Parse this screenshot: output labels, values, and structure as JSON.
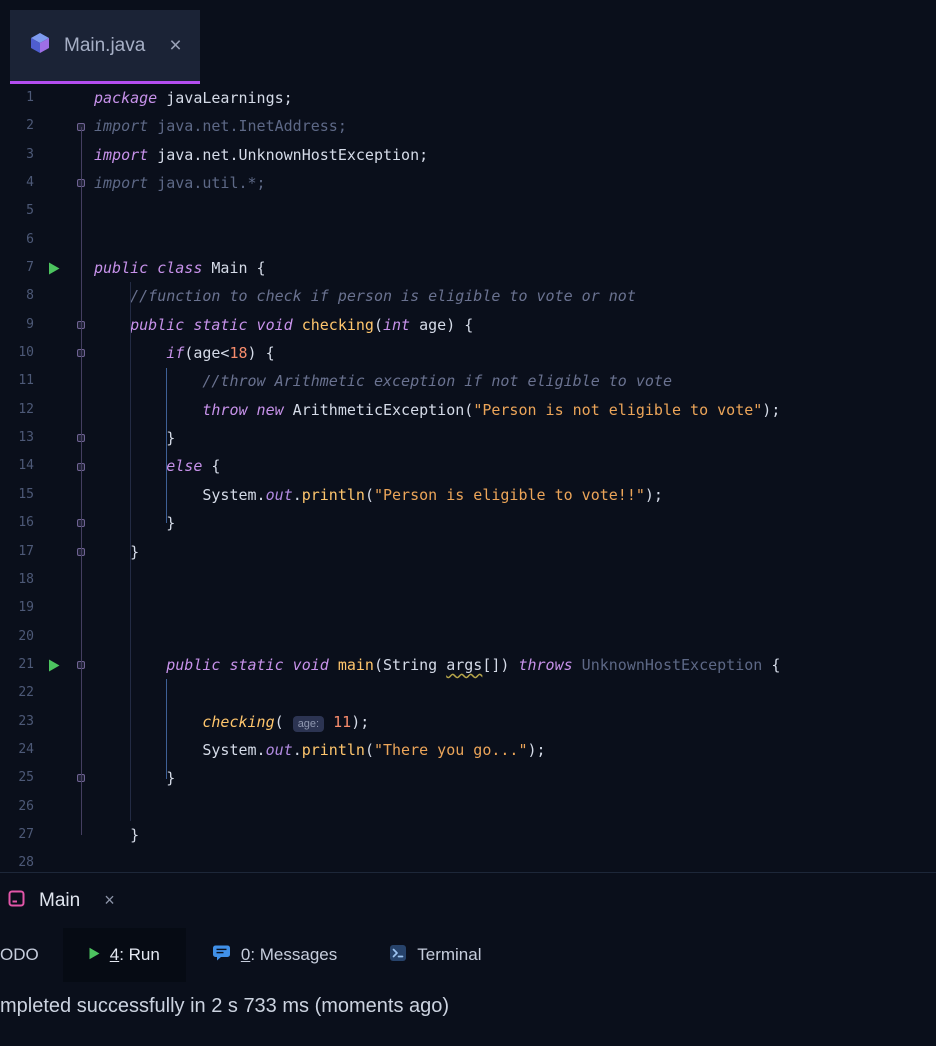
{
  "colors": {
    "background": "#0a0f1b",
    "tab_background": "#1b2336",
    "tab_underline_accent": "#b44df0",
    "keyword": "#c792ea",
    "plain_text": "#d5dbe8",
    "unused_code": "#5d6886",
    "comment": "#6a7290",
    "string": "#eca559",
    "number": "#f78c6c",
    "method": "#ffc66d",
    "field": "#b18ae0",
    "line_number": "#4d5977",
    "fold_marker": "#6f6393",
    "run_icon_green": "#4cc45f",
    "console_icon_pink": "#e256a8",
    "messages_icon_blue": "#4090e8",
    "inlay_chip_bg": "#2c3452",
    "inlay_chip_text": "#8f97b0"
  },
  "editor_tab": {
    "title": "Main.java",
    "close_label": "×"
  },
  "editor": {
    "run_lines": [
      7,
      21
    ],
    "fold_lines": [
      2,
      4,
      9,
      10,
      13,
      14,
      16,
      17,
      21,
      25
    ],
    "lines": [
      {
        "n": 1,
        "tokens": [
          [
            "kw",
            "package"
          ],
          [
            "pl",
            " javaLearnings;"
          ]
        ]
      },
      {
        "n": 2,
        "tokens": [
          [
            "gri",
            "import"
          ],
          [
            "gr",
            " java.net.InetAddress;"
          ]
        ]
      },
      {
        "n": 3,
        "tokens": [
          [
            "kw",
            "import"
          ],
          [
            "pl",
            " java.net.UnknownHostException;"
          ]
        ]
      },
      {
        "n": 4,
        "tokens": [
          [
            "gri",
            "import"
          ],
          [
            "gr",
            " java.util.*;"
          ]
        ]
      },
      {
        "n": 5,
        "tokens": []
      },
      {
        "n": 6,
        "tokens": []
      },
      {
        "n": 7,
        "tokens": [
          [
            "kw",
            "public class"
          ],
          [
            "pl",
            " Main {"
          ]
        ]
      },
      {
        "n": 8,
        "tokens": [
          [
            "cm",
            "    //function to check if person is eligible to vote or not"
          ]
        ]
      },
      {
        "n": 9,
        "tokens": [
          [
            "pl",
            "    "
          ],
          [
            "kw",
            "public static void"
          ],
          [
            "pl",
            " "
          ],
          [
            "fn",
            "checking"
          ],
          [
            "pl",
            "("
          ],
          [
            "kw",
            "int"
          ],
          [
            "pl",
            " age) {"
          ]
        ]
      },
      {
        "n": 10,
        "tokens": [
          [
            "pl",
            "        "
          ],
          [
            "kw",
            "if"
          ],
          [
            "pl",
            "(age<"
          ],
          [
            "nm",
            "18"
          ],
          [
            "pl",
            ") {"
          ]
        ]
      },
      {
        "n": 11,
        "tokens": [
          [
            "cm",
            "            //throw Arithmetic exception if not eligible to vote"
          ]
        ]
      },
      {
        "n": 12,
        "tokens": [
          [
            "pl",
            "            "
          ],
          [
            "kw",
            "throw new"
          ],
          [
            "pl",
            " ArithmeticException("
          ],
          [
            "st",
            "\"Person is not eligible to vote\""
          ],
          [
            "pl",
            ");"
          ]
        ]
      },
      {
        "n": 13,
        "tokens": [
          [
            "pl",
            "        }"
          ]
        ]
      },
      {
        "n": 14,
        "tokens": [
          [
            "pl",
            "        "
          ],
          [
            "kw",
            "else"
          ],
          [
            "pl",
            " {"
          ]
        ]
      },
      {
        "n": 15,
        "tokens": [
          [
            "pl",
            "            System."
          ],
          [
            "fd",
            "out"
          ],
          [
            "pl",
            "."
          ],
          [
            "fn",
            "println"
          ],
          [
            "pl",
            "("
          ],
          [
            "st",
            "\"Person is eligible to vote!!\""
          ],
          [
            "pl",
            ");"
          ]
        ]
      },
      {
        "n": 16,
        "tokens": [
          [
            "pl",
            "        }"
          ]
        ]
      },
      {
        "n": 17,
        "tokens": [
          [
            "pl",
            "    }"
          ]
        ]
      },
      {
        "n": 18,
        "tokens": []
      },
      {
        "n": 19,
        "tokens": []
      },
      {
        "n": 20,
        "tokens": []
      },
      {
        "n": 21,
        "tokens": [
          [
            "pl",
            "        "
          ],
          [
            "kw",
            "public static void"
          ],
          [
            "pl",
            " "
          ],
          [
            "fn",
            "main"
          ],
          [
            "pl",
            "(String "
          ],
          [
            "wv",
            "args"
          ],
          [
            "pl",
            "[]) "
          ],
          [
            "kw",
            "throws"
          ],
          [
            "gr",
            " UnknownHostException"
          ],
          [
            "pl",
            " {"
          ]
        ]
      },
      {
        "n": 22,
        "tokens": []
      },
      {
        "n": 23,
        "tokens": [
          [
            "pl",
            "            "
          ],
          [
            "fni",
            "checking"
          ],
          [
            "pl",
            "( "
          ],
          [
            "in",
            "age:"
          ],
          [
            "pl",
            " "
          ],
          [
            "nm",
            "11"
          ],
          [
            "pl",
            ");"
          ]
        ]
      },
      {
        "n": 24,
        "tokens": [
          [
            "pl",
            "            System."
          ],
          [
            "fd",
            "out"
          ],
          [
            "pl",
            "."
          ],
          [
            "fn",
            "println"
          ],
          [
            "pl",
            "("
          ],
          [
            "st",
            "\"There you go...\""
          ],
          [
            "pl",
            ");"
          ]
        ]
      },
      {
        "n": 25,
        "tokens": [
          [
            "pl",
            "        }"
          ]
        ]
      },
      {
        "n": 26,
        "tokens": []
      },
      {
        "n": 27,
        "tokens": [
          [
            "pl",
            "    }"
          ]
        ]
      },
      {
        "n": 28,
        "tokens": []
      }
    ]
  },
  "tool_window": {
    "title": "Main",
    "close_label": "×",
    "todo_truncated": "ODO",
    "tabs": {
      "run": {
        "mnemonic": "4",
        "suffix": ": Run"
      },
      "messages": {
        "mnemonic": "0",
        "suffix": ": Messages"
      },
      "terminal": {
        "label": "Terminal"
      }
    },
    "status_text": "mpleted successfully in 2 s 733 ms (moments ago)"
  }
}
